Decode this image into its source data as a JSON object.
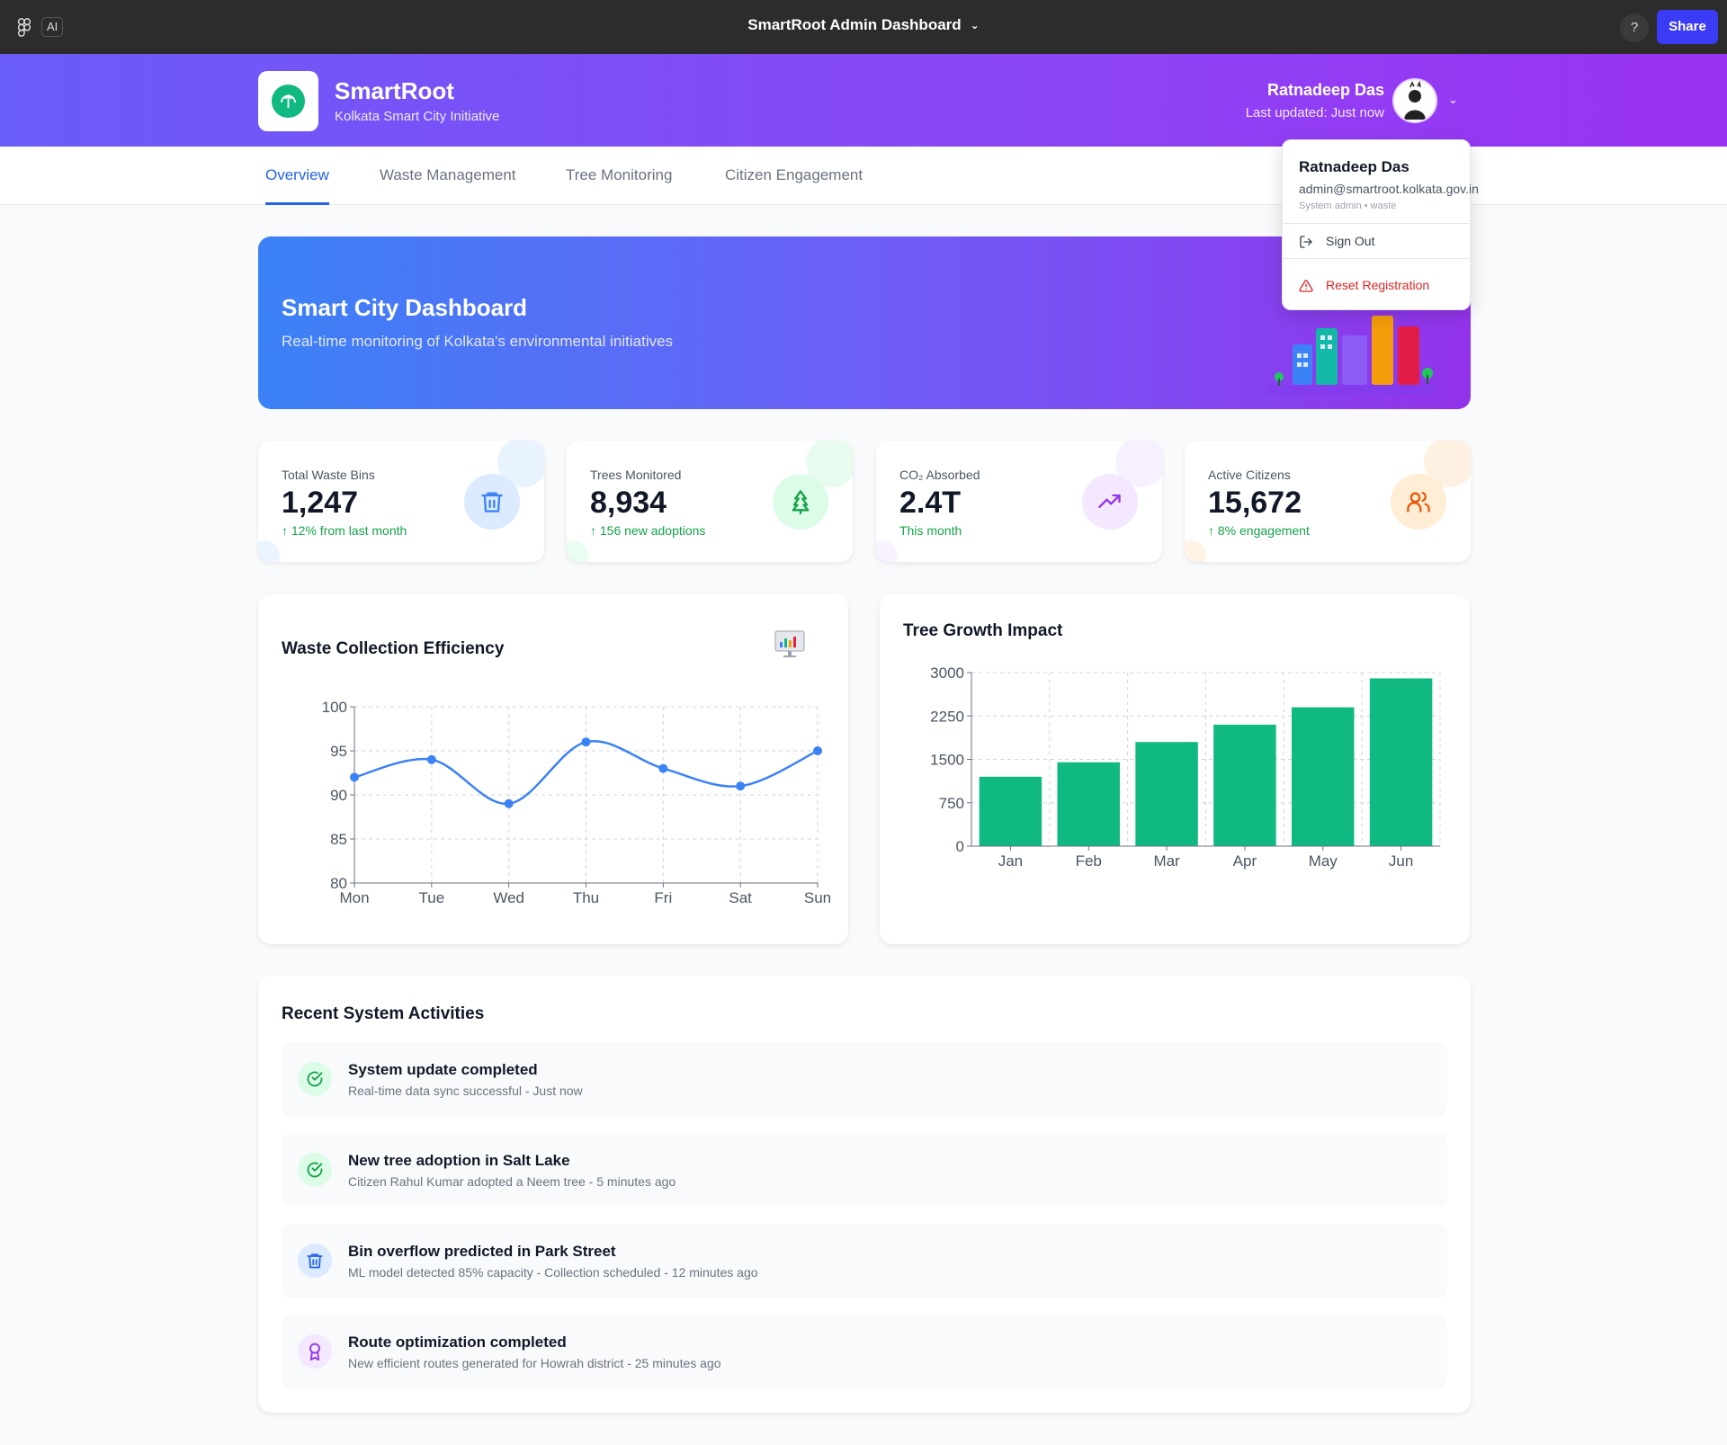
{
  "app_bar": {
    "ai_badge": "AI",
    "title": "SmartRoot Admin Dashboard",
    "help": "?",
    "share": "Share"
  },
  "header": {
    "brand": "SmartRoot",
    "subtitle": "Kolkata Smart City Initiative",
    "user_name": "Ratnadeep Das",
    "last_updated": "Last updated: Just now"
  },
  "nav": {
    "tabs": [
      {
        "label": "Overview",
        "active": true
      },
      {
        "label": "Waste Management",
        "active": false
      },
      {
        "label": "Tree Monitoring",
        "active": false
      },
      {
        "label": "Citizen Engagement",
        "active": false
      }
    ]
  },
  "hero": {
    "title": "Smart City Dashboard",
    "subtitle": "Real-time monitoring of Kolkata's environmental initiatives"
  },
  "stats": [
    {
      "label": "Total Waste Bins",
      "value": "1,247",
      "delta": "↑ 12% from last month",
      "icon": "trash-icon",
      "color": "#3b82f6"
    },
    {
      "label": "Trees Monitored",
      "value": "8,934",
      "delta": "↑ 156 new adoptions",
      "icon": "tree-icon",
      "color": "#16a34a"
    },
    {
      "label": "CO₂ Absorbed",
      "value": "2.4T",
      "delta": "This month",
      "icon": "trending-up-icon",
      "color": "#9333ea"
    },
    {
      "label": "Active Citizens",
      "value": "15,672",
      "delta": "↑ 8% engagement",
      "icon": "users-icon",
      "color": "#ea580c"
    }
  ],
  "charts": {
    "waste_title": "Waste Collection Efficiency",
    "tree_title": "Tree Growth Impact"
  },
  "chart_data": [
    {
      "type": "line",
      "title": "Waste Collection Efficiency",
      "categories": [
        "Mon",
        "Tue",
        "Wed",
        "Thu",
        "Fri",
        "Sat",
        "Sun"
      ],
      "values": [
        92,
        94,
        89,
        96,
        93,
        91,
        95
      ],
      "ylim": [
        80,
        100
      ],
      "yticks": [
        80,
        85,
        90,
        95,
        100
      ],
      "color": "#3b82f6",
      "grid": true
    },
    {
      "type": "bar",
      "title": "Tree Growth Impact",
      "categories": [
        "Jan",
        "Feb",
        "Mar",
        "Apr",
        "May",
        "Jun"
      ],
      "values": [
        1200,
        1450,
        1800,
        2100,
        2400,
        2900
      ],
      "ylim": [
        0,
        3000
      ],
      "yticks": [
        0,
        750,
        1500,
        2250,
        3000
      ],
      "color": "#10b981",
      "grid": true
    }
  ],
  "activities": {
    "title": "Recent System Activities",
    "items": [
      {
        "title": "System update completed",
        "desc": "Real-time data sync successful - Just now",
        "icon": "check-circle-icon",
        "color": "#16a34a",
        "bg": "#dcfce7"
      },
      {
        "title": "New tree adoption in Salt Lake",
        "desc": "Citizen Rahul Kumar adopted a Neem tree - 5 minutes ago",
        "icon": "check-circle-icon",
        "color": "#16a34a",
        "bg": "#dcfce7"
      },
      {
        "title": "Bin overflow predicted in Park Street",
        "desc": "ML model detected 85% capacity - Collection scheduled - 12 minutes ago",
        "icon": "trash-icon",
        "color": "#2563eb",
        "bg": "#dbeafe"
      },
      {
        "title": "Route optimization completed",
        "desc": "New efficient routes generated for Howrah district - 25 minutes ago",
        "icon": "award-icon",
        "color": "#9333ea",
        "bg": "#f3e8ff"
      }
    ]
  },
  "dropdown": {
    "name": "Ratnadeep Das",
    "email": "admin@smartroot.kolkata.gov.in",
    "role": "System admin • waste",
    "sign_out": "Sign Out",
    "reset": "Reset Registration"
  }
}
